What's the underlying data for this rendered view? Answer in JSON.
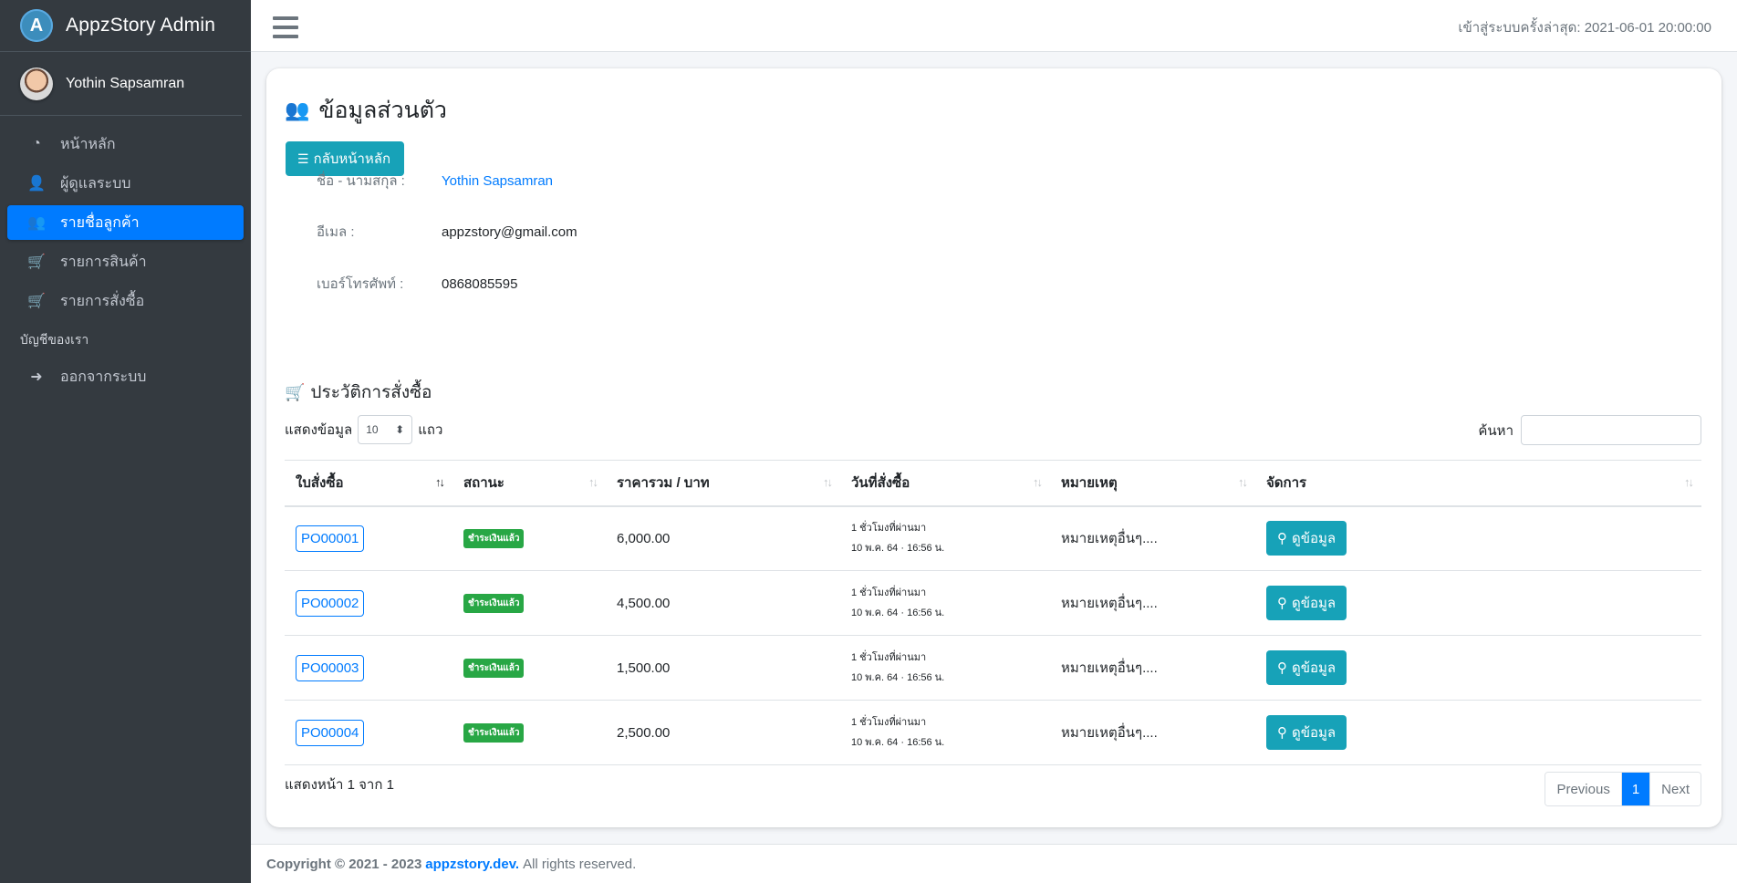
{
  "app": {
    "brand": "AppzStory Admin",
    "logo_letter": "A"
  },
  "user": {
    "name": "Yothin Sapsamran"
  },
  "sidebar": {
    "items": [
      {
        "label": "หน้าหลัก",
        "icon": "dashboard-icon",
        "glyph": "◔"
      },
      {
        "label": "ผู้ดูแลระบบ",
        "icon": "user-cog-icon",
        "glyph": "👤"
      },
      {
        "label": "รายชื่อลูกค้า",
        "icon": "users-icon",
        "glyph": "👥",
        "active": true
      },
      {
        "label": "รายการสินค้า",
        "icon": "cart-icon",
        "glyph": "🛒"
      },
      {
        "label": "รายการสั่งซื้อ",
        "icon": "cart-plus-icon",
        "glyph": "🛒"
      }
    ],
    "section_header": "บัญชีของเรา",
    "logout": {
      "label": "ออกจากระบบ",
      "icon": "sign-out-icon",
      "glyph": "➜"
    }
  },
  "header": {
    "last_login": "เข้าสู่ระบบครั้งล่าสุด: 2021-06-01 20:00:00"
  },
  "profile": {
    "title": "ข้อมูลส่วนตัว",
    "back_button": "กลับหน้าหลัก",
    "fields": [
      {
        "label": "ชื่อ - นามสกุล :",
        "value": "Yothin Sapsamran",
        "link": true
      },
      {
        "label": "อีเมล :",
        "value": "appzstory@gmail.com"
      },
      {
        "label": "เบอร์โทรศัพท์ :",
        "value": "0868085595"
      }
    ]
  },
  "orders": {
    "title": "ประวัติการสั่งซื้อ",
    "length_label_before": "แสดงข้อมูล",
    "length_value": "10",
    "length_label_after": "แถว",
    "search_label": "ค้นหา",
    "columns": [
      "ใบสั่งซื้อ",
      "สถานะ",
      "ราคารวม / บาท",
      "วันที่สั่งซื้อ",
      "หมายเหตุ",
      "จัดการ"
    ],
    "rows": [
      {
        "po": "PO00001",
        "status": "ชำระเงินแล้ว",
        "total": "6,000.00",
        "date_rel": "1 ชั่วโมงที่ผ่านมา",
        "date_abs": "10 พ.ค. 64 · 16:56 น.",
        "note": "หมายเหตุอื่นๆ....",
        "action": "ดูข้อมูล"
      },
      {
        "po": "PO00002",
        "status": "ชำระเงินแล้ว",
        "total": "4,500.00",
        "date_rel": "1 ชั่วโมงที่ผ่านมา",
        "date_abs": "10 พ.ค. 64 · 16:56 น.",
        "note": "หมายเหตุอื่นๆ....",
        "action": "ดูข้อมูล"
      },
      {
        "po": "PO00003",
        "status": "ชำระเงินแล้ว",
        "total": "1,500.00",
        "date_rel": "1 ชั่วโมงที่ผ่านมา",
        "date_abs": "10 พ.ค. 64 · 16:56 น.",
        "note": "หมายเหตุอื่นๆ....",
        "action": "ดูข้อมูล"
      },
      {
        "po": "PO00004",
        "status": "ชำระเงินแล้ว",
        "total": "2,500.00",
        "date_rel": "1 ชั่วโมงที่ผ่านมา",
        "date_abs": "10 พ.ค. 64 · 16:56 น.",
        "note": "หมายเหตุอื่นๆ....",
        "action": "ดูข้อมูล"
      }
    ],
    "page_info": "แสดงหน้า 1 จาก 1",
    "pager": {
      "prev": "Previous",
      "current": "1",
      "next": "Next"
    }
  },
  "footer": {
    "prefix": "Copyright © 2021 - 2023",
    "link": "appzstory.dev.",
    "suffix": "All rights reserved."
  },
  "colors": {
    "primary": "#007bff",
    "info": "#17a2b8",
    "success": "#28a745",
    "sidebar": "#343a40"
  }
}
